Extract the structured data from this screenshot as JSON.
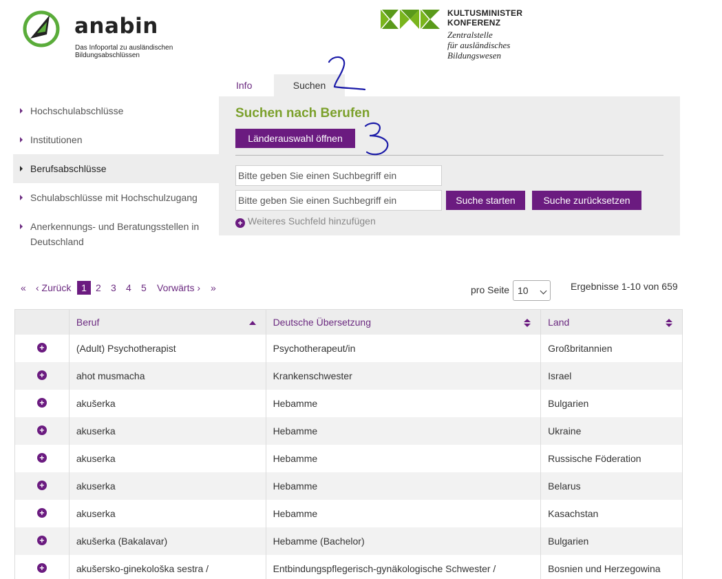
{
  "header": {
    "anabin": {
      "name": "anabin",
      "tagline_1": "Das Infoportal zu ausländischen",
      "tagline_2": "Bildungsabschlüssen"
    },
    "kmk": {
      "title_1": "KULTUSMINISTER",
      "title_2": "KONFERENZ",
      "sub_1": "Zentralstelle",
      "sub_2": "für ausländisches",
      "sub_3": "Bildungswesen"
    }
  },
  "tabs": {
    "info": "Info",
    "suchen": "Suchen"
  },
  "sidebar": {
    "items": [
      {
        "label": "Hochschulabschlüsse"
      },
      {
        "label": "Institutionen"
      },
      {
        "label": "Berufsabschlüsse"
      },
      {
        "label": "Schulabschlüsse mit Hochschulzugang"
      },
      {
        "label": "Anerkennungs- und Beratungsstellen in Deutschland"
      }
    ]
  },
  "search": {
    "heading": "Suchen nach Berufen",
    "countries_button": "Länderauswahl öffnen",
    "placeholder": "Bitte geben Sie einen Suchbegriff ein",
    "start_button": "Suche starten",
    "reset_button": "Suche zurücksetzen",
    "add_field": "Weiteres Suchfeld hinzufügen"
  },
  "pagination": {
    "first": "«",
    "prev": "‹ Zurück",
    "pages": [
      "1",
      "2",
      "3",
      "4",
      "5"
    ],
    "next": "Vorwärts ›",
    "last": "»",
    "per_page_label": "pro Seite",
    "per_page_value": "10",
    "results": "Ergebnisse 1-10 von 659"
  },
  "table": {
    "headers": {
      "beruf": "Beruf",
      "de": "Deutsche Übersetzung",
      "land": "Land"
    },
    "rows": [
      {
        "beruf": "(Adult) Psychotherapist",
        "de": "Psychotherapeut/in",
        "land": "Großbritannien"
      },
      {
        "beruf": "ahot musmacha",
        "de": "Krankenschwester",
        "land": "Israel"
      },
      {
        "beruf": "akušerka",
        "de": "Hebamme",
        "land": "Bulgarien"
      },
      {
        "beruf": "akuserka",
        "de": "Hebamme",
        "land": "Ukraine"
      },
      {
        "beruf": "akuserka",
        "de": "Hebamme",
        "land": "Russische Föderation"
      },
      {
        "beruf": "akuserka",
        "de": "Hebamme",
        "land": "Belarus"
      },
      {
        "beruf": "akuserka",
        "de": "Hebamme",
        "land": "Kasachstan"
      },
      {
        "beruf": "akušerka (Bakalavar)",
        "de": "Hebamme (Bachelor)",
        "land": "Bulgarien"
      },
      {
        "beruf": "akušersko-ginekološka sestra /",
        "de": "Entbindungspflegerisch-gynäkologische Schwester /",
        "land": "Bosnien und Herzegowina"
      }
    ]
  },
  "colors": {
    "accent": "#6b1b80",
    "heading_green": "#7ba02b",
    "panel_bg": "#ededed"
  }
}
